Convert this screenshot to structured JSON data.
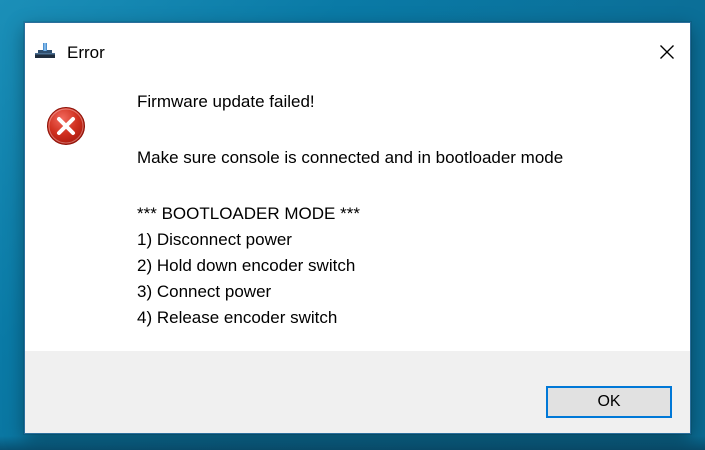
{
  "window": {
    "title": "Error",
    "app_icon": "tool-app-icon",
    "close_icon": "close-icon"
  },
  "dialog": {
    "icon": "error-icon",
    "icon_color": "#c42b1c",
    "heading": "Firmware update failed!",
    "instruction": "Make sure console is connected and in bootloader mode",
    "bootloader_title": "*** BOOTLOADER MODE ***",
    "steps": [
      "1) Disconnect power",
      "2) Hold down encoder switch",
      "3) Connect power",
      "4) Release encoder switch"
    ]
  },
  "buttons": {
    "ok_label": "OK",
    "accent_color": "#0078d7"
  }
}
